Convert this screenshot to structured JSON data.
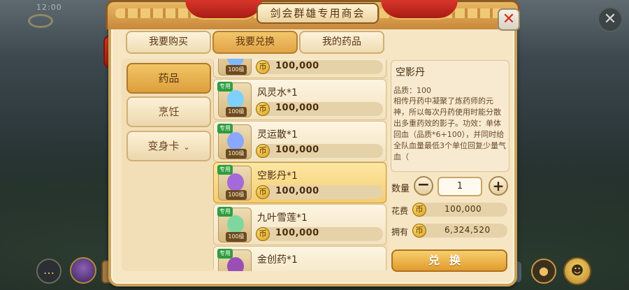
{
  "status_bar": {
    "text": "12:00"
  },
  "background_close": {
    "icon": "close-icon",
    "glyph": "✕"
  },
  "window": {
    "title": "剑会群雄专用商会",
    "close_glyph": "✕"
  },
  "tabs": [
    {
      "label": "我要购买",
      "active": false
    },
    {
      "label": "我要兑换",
      "active": true
    },
    {
      "label": "我的药品",
      "active": false
    }
  ],
  "categories": [
    {
      "label": "药品",
      "active": true
    },
    {
      "label": "烹饪",
      "active": false
    },
    {
      "label": "变身卡",
      "active": false,
      "chevron": "⌄"
    }
  ],
  "items": [
    {
      "name": "",
      "tag": "",
      "level": "100级",
      "price": "100,000",
      "icon_color": "#7fb8ff"
    },
    {
      "name": "风灵水*1",
      "tag": "专用",
      "level": "100级",
      "price": "100,000",
      "icon_color": "#7fd0ff"
    },
    {
      "name": "灵运散*1",
      "tag": "专用",
      "level": "100级",
      "price": "100,000",
      "icon_color": "#8aa8ff"
    },
    {
      "name": "空影丹*1",
      "tag": "专用",
      "level": "100级",
      "price": "100,000",
      "icon_color": "#a46ad8",
      "selected": true
    },
    {
      "name": "九叶雪莲*1",
      "tag": "专用",
      "level": "100级",
      "price": "100,000",
      "icon_color": "#7fd7a0"
    },
    {
      "name": "金创药*1",
      "tag": "专用",
      "level": "",
      "price": "",
      "icon_color": "#9b4fb4"
    }
  ],
  "coin_glyph": "币",
  "detail": {
    "name": "空影丹",
    "quality": "品质：100",
    "description": "相传丹药中凝聚了炼药师的元神，所以每次丹药使用时能分散出多重药效的影子。功效：单体回血（品质*6+100），并同时给全队血量最低3个单位回复少量气血（"
  },
  "quantity": {
    "label": "数量",
    "value": "1",
    "minus": "−",
    "plus": "+"
  },
  "cost": {
    "label": "花费",
    "value": "100,000"
  },
  "owned": {
    "label": "拥有",
    "value": "6,324,520"
  },
  "exchange_button": {
    "label": "兑换"
  },
  "hud": {
    "chat_glyph": "…",
    "camera_glyph": "●",
    "pet_glyph": "☻"
  },
  "colors": {
    "accent": "#e0a448",
    "panel": "#f6e6c4",
    "close": "#d42b1f",
    "tag_green": "#2e9d3f"
  }
}
